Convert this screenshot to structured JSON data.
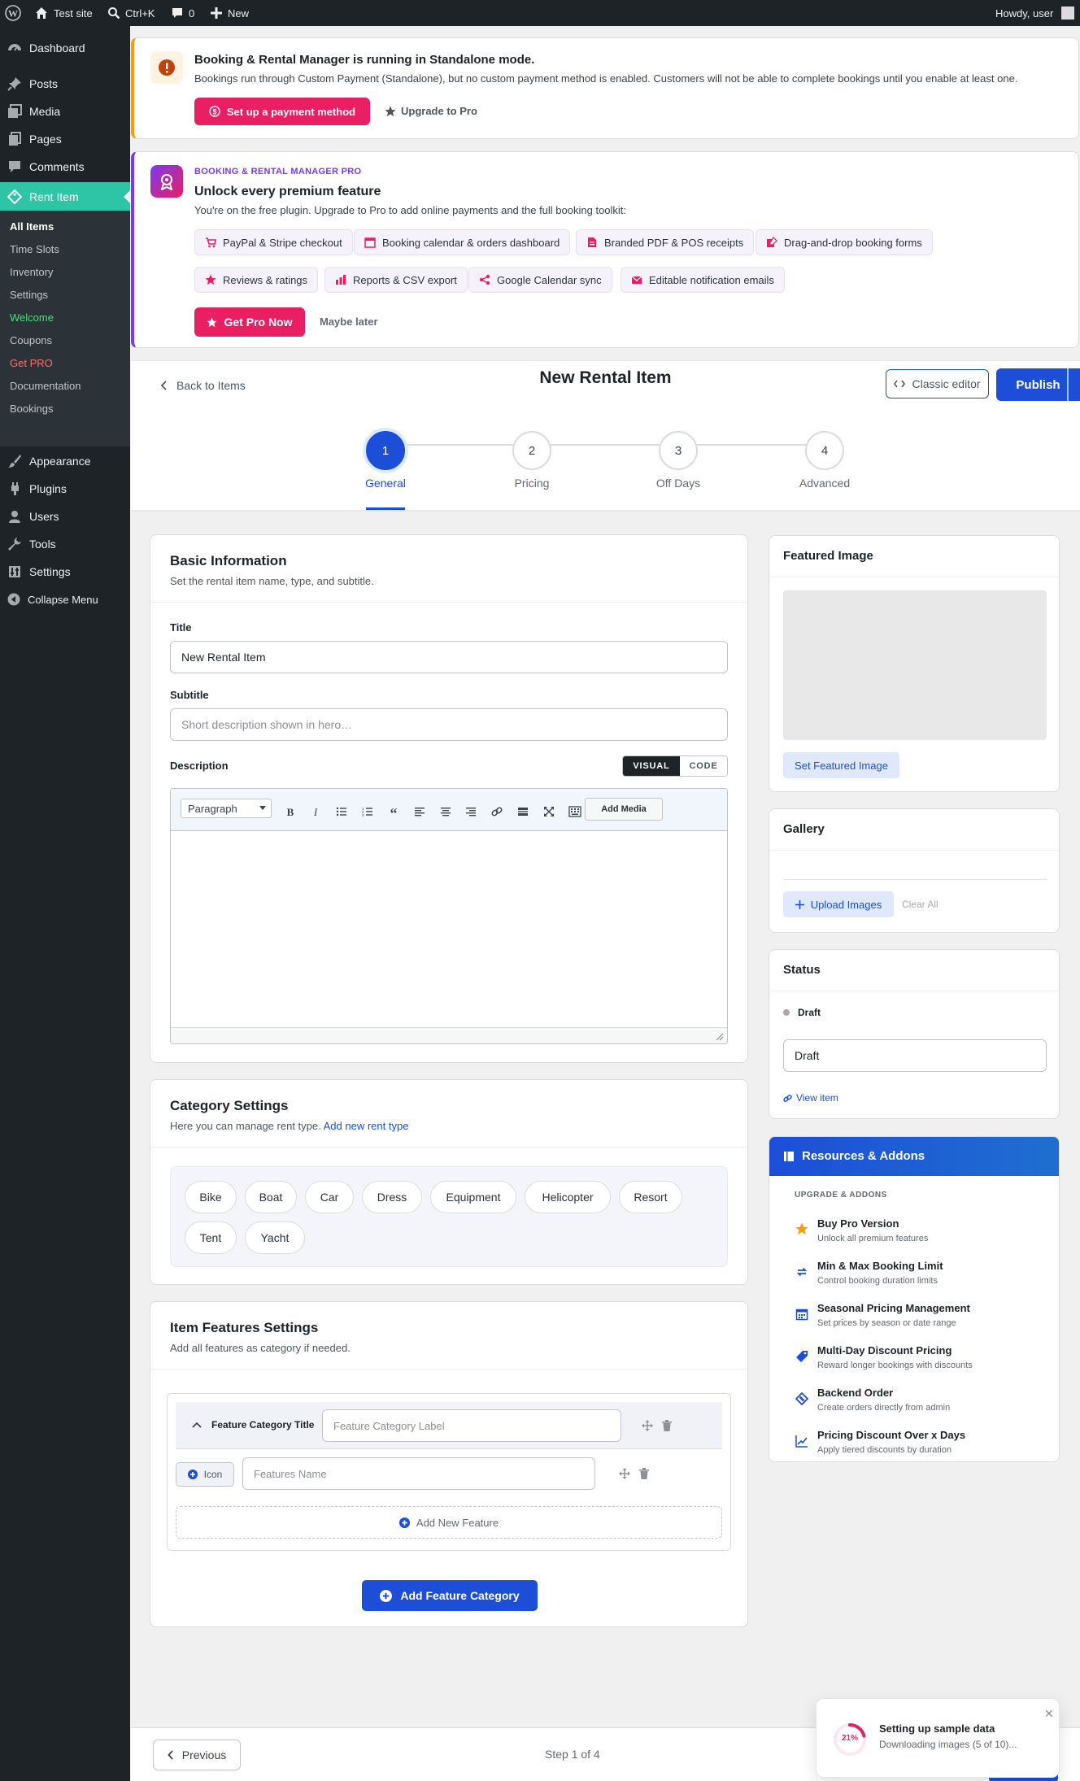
{
  "admin_bar": {
    "site": "Test site",
    "search": "Ctrl+K",
    "comments": "0",
    "new": "New",
    "howdy": "Howdy, user"
  },
  "sidebar": {
    "items": [
      {
        "label": "Dashboard",
        "icon": "dashboard-icon"
      },
      {
        "label": "Posts",
        "icon": "pin-icon"
      },
      {
        "label": "Media",
        "icon": "media-icon"
      },
      {
        "label": "Pages",
        "icon": "pages-icon"
      },
      {
        "label": "Comments",
        "icon": "comment-icon"
      },
      {
        "label": "Rent Item",
        "icon": "tag-icon"
      },
      {
        "label": "Appearance",
        "icon": "brush-icon"
      },
      {
        "label": "Plugins",
        "icon": "plug-icon"
      },
      {
        "label": "Users",
        "icon": "user-icon"
      },
      {
        "label": "Tools",
        "icon": "wrench-icon"
      },
      {
        "label": "Settings",
        "icon": "settings-icon"
      },
      {
        "label": "Collapse Menu",
        "icon": "collapse-icon"
      }
    ],
    "submenu": [
      "All Items",
      "Time Slots",
      "Inventory",
      "Settings",
      "Welcome",
      "Coupons",
      "Get PRO",
      "Documentation",
      "Bookings"
    ]
  },
  "notice_standalone": {
    "title": "Booking & Rental Manager is running in Standalone mode.",
    "text": "Bookings run through Custom Payment (Standalone), but no custom payment method is enabled. Customers will not be able to complete bookings until you enable at least one.",
    "primary": "Set up a payment method",
    "secondary": "Upgrade to Pro"
  },
  "pro_notice": {
    "kicker": "BOOKING & RENTAL MANAGER PRO",
    "title": "Unlock every premium feature",
    "text": "You're on the free plugin. Upgrade to Pro to add online payments and the full booking toolkit:",
    "features": [
      "PayPal & Stripe checkout",
      "Booking calendar & orders dashboard",
      "Branded PDF & POS receipts",
      "Drag-and-drop booking forms",
      "Reviews & ratings",
      "Reports & CSV export",
      "Google Calendar sync",
      "Editable notification emails"
    ],
    "cta": "Get Pro Now",
    "dismiss": "Maybe later"
  },
  "editor_header": {
    "back": "Back to Items",
    "title": "New Rental Item",
    "classic": "Classic editor",
    "publish": "Publish"
  },
  "steps": [
    {
      "num": "1",
      "label": "General"
    },
    {
      "num": "2",
      "label": "Pricing"
    },
    {
      "num": "3",
      "label": "Off Days"
    },
    {
      "num": "4",
      "label": "Advanced"
    }
  ],
  "basic": {
    "title": "Basic Information",
    "subtitle": "Set the rental item name, type, and subtitle.",
    "title_label": "Title",
    "title_value": "New Rental Item",
    "subtitle_label": "Subtitle",
    "subtitle_placeholder": "Short description shown in hero…",
    "desc_label": "Description",
    "visual": "VISUAL",
    "code": "CODE",
    "format": "Paragraph",
    "add_media": "Add Media"
  },
  "category": {
    "title": "Category Settings",
    "subtitle": "Here you can manage rent type.",
    "link": "Add new rent type",
    "items": [
      "Bike",
      "Boat",
      "Car",
      "Dress",
      "Equipment",
      "Helicopter",
      "Resort",
      "Tent",
      "Yacht"
    ]
  },
  "features": {
    "title": "Item Features Settings",
    "subtitle": "Add all features as category if needed.",
    "cat_title": "Feature Category Title",
    "cat_placeholder": "Feature Category Label",
    "icon": "Icon",
    "name_placeholder": "Features Name",
    "add_feature": "Add New Feature",
    "add_category": "Add Feature Category"
  },
  "featured_image": {
    "title": "Featured Image",
    "button": "Set Featured Image"
  },
  "gallery": {
    "title": "Gallery",
    "upload": "Upload Images",
    "clear": "Clear All"
  },
  "status": {
    "title": "Status",
    "badge": "Draft",
    "select": "Draft",
    "view": "View item"
  },
  "resources": {
    "title": "Resources & Addons",
    "section": "UPGRADE & ADDONS",
    "items": [
      {
        "title": "Buy Pro Version",
        "desc": "Unlock all premium features"
      },
      {
        "title": "Min & Max Booking Limit",
        "desc": "Control booking duration limits"
      },
      {
        "title": "Seasonal Pricing Management",
        "desc": "Set prices by season or date range"
      },
      {
        "title": "Multi-Day Discount Pricing",
        "desc": "Reward longer bookings with discounts"
      },
      {
        "title": "Backend Order",
        "desc": "Create orders directly from admin"
      },
      {
        "title": "Pricing Discount Over x Days",
        "desc": "Apply tiered discounts by duration"
      }
    ]
  },
  "toast": {
    "percent": "21%",
    "progress": 0.21,
    "title": "Setting up sample data",
    "text": "Downloading images (5 of 10)..."
  },
  "footer": {
    "previous": "Previous",
    "step": "Step 1 of 4"
  },
  "colors": {
    "accent": "#1d4ed8",
    "pink": "#e91e63",
    "purple": "#7c3aed",
    "teal": "#2ec4a6"
  }
}
